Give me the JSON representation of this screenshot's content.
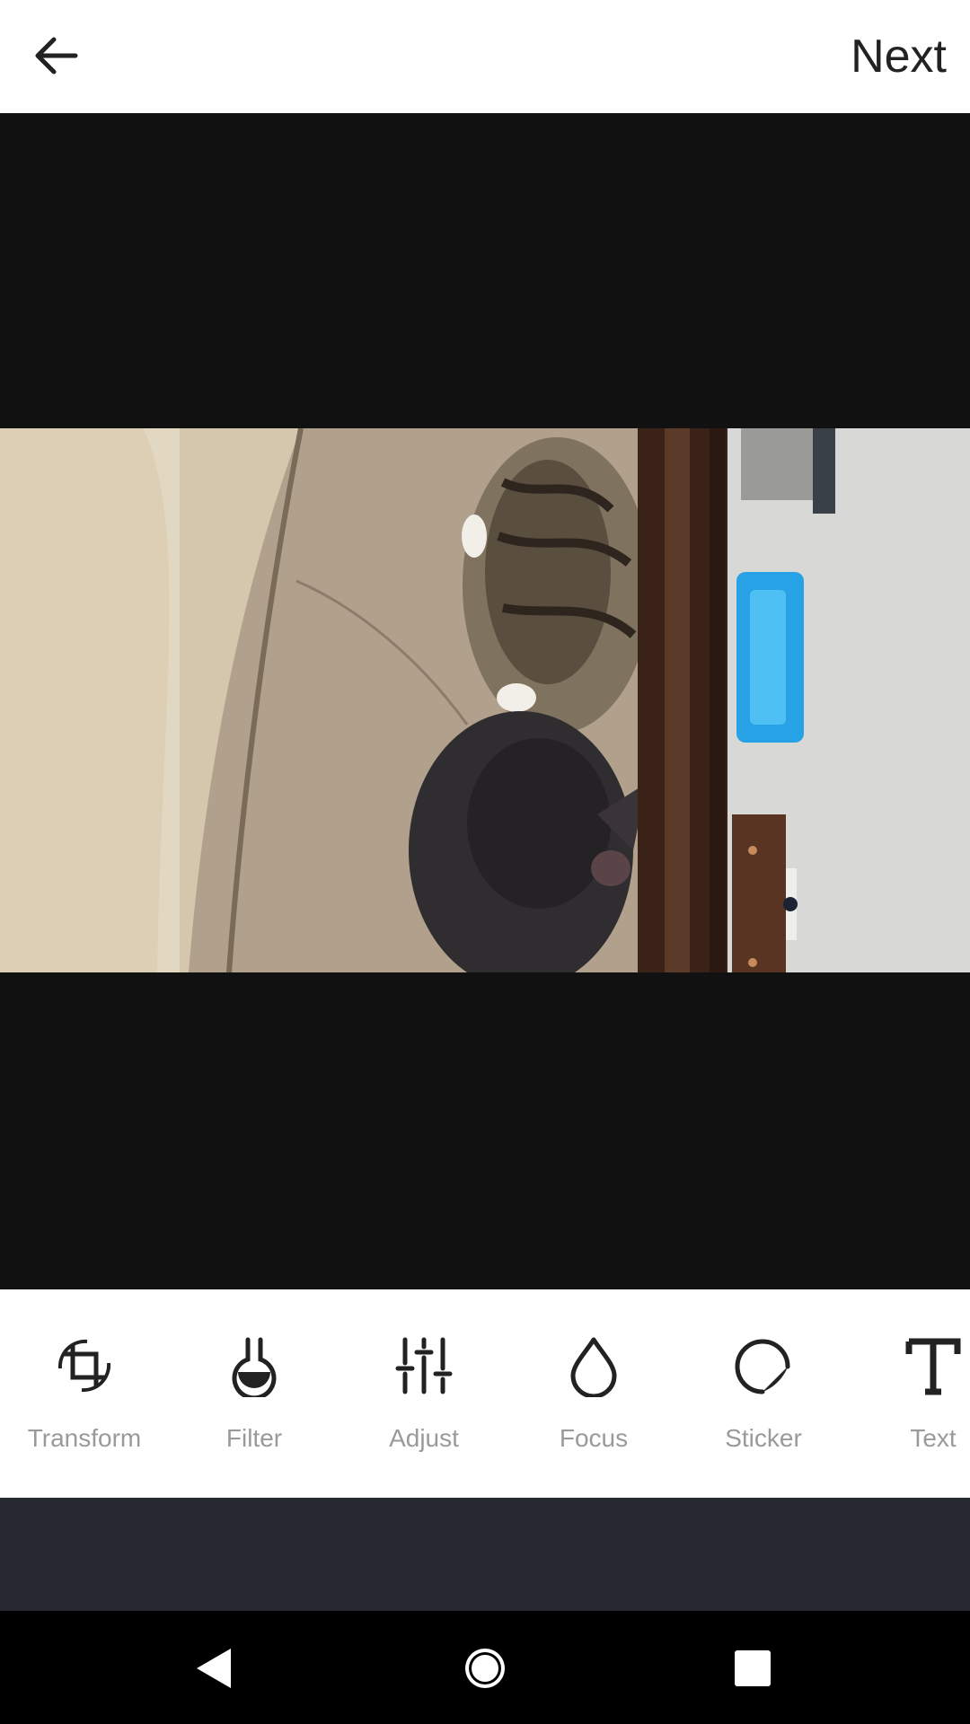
{
  "header": {
    "back_icon": "arrow-left-icon",
    "next_label": "Next"
  },
  "photo": {
    "description_icon": "photo"
  },
  "history": {
    "undo_icon": "undo-icon",
    "redo_icon": "redo-icon"
  },
  "tools": [
    {
      "label": "Transform",
      "icon": "crop-rotate-icon"
    },
    {
      "label": "Filter",
      "icon": "filter-flask-icon"
    },
    {
      "label": "Adjust",
      "icon": "sliders-icon"
    },
    {
      "label": "Focus",
      "icon": "droplet-icon"
    },
    {
      "label": "Sticker",
      "icon": "sticker-icon"
    },
    {
      "label": "Text",
      "icon": "text-icon"
    }
  ],
  "system_nav": {
    "back_icon": "nav-back-icon",
    "home_icon": "nav-home-icon",
    "recents_icon": "nav-recents-icon"
  },
  "colors": {
    "canvas_bg": "#111112",
    "toolbar_bg": "#ffffff",
    "label_color": "#9a9a9a",
    "icon_color": "#222222",
    "strip_bg": "#272931"
  }
}
